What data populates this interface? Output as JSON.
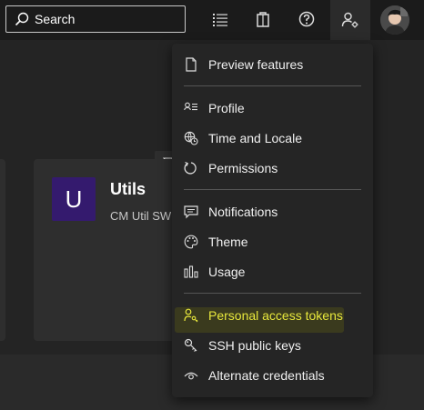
{
  "topbar": {
    "search": {
      "label": "Search",
      "icon": "search-icon"
    },
    "icons": [
      "list-icon",
      "shopping-bag-icon",
      "help-icon",
      "user-settings-icon"
    ],
    "avatar": "avatar"
  },
  "project_card": {
    "tile_letter": "U",
    "tile_color": "#341a6e",
    "title": "Utils",
    "description": "CM Util SW"
  },
  "menu": {
    "items": [
      {
        "label": "Preview features",
        "icon": "document-icon"
      },
      {
        "label": "Profile",
        "icon": "profile-icon"
      },
      {
        "label": "Time and Locale",
        "icon": "globe-clock-icon"
      },
      {
        "label": "Permissions",
        "icon": "refresh-icon"
      },
      {
        "label": "Notifications",
        "icon": "chat-icon"
      },
      {
        "label": "Theme",
        "icon": "palette-icon"
      },
      {
        "label": "Usage",
        "icon": "bar-chart-icon"
      },
      {
        "label": "Personal access tokens",
        "icon": "key-person-icon",
        "highlighted": true
      },
      {
        "label": "SSH public keys",
        "icon": "key-icon"
      },
      {
        "label": "Alternate credentials",
        "icon": "eye-icon"
      }
    ],
    "highlight_color": "#e8e83c"
  }
}
